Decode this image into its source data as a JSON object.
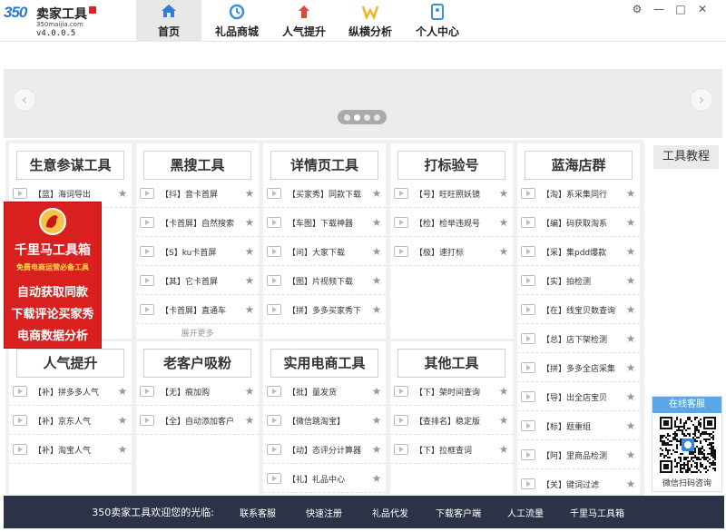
{
  "app": {
    "logo_mark": "350",
    "logo_name": "卖家工具",
    "logo_url": "350maijia.com",
    "version": "v4.0.0.5"
  },
  "nav": {
    "tabs": [
      {
        "label": "首页",
        "icon": "home-icon",
        "active": true
      },
      {
        "label": "礼品商城",
        "icon": "gift-mall-icon",
        "active": false
      },
      {
        "label": "人气提升",
        "icon": "popularity-icon",
        "active": false
      },
      {
        "label": "纵横分析",
        "icon": "analysis-icon",
        "active": false
      },
      {
        "label": "个人中心",
        "icon": "personal-center-icon",
        "active": false
      }
    ]
  },
  "window": {
    "settings": "⚙",
    "minimize": "—",
    "maximize": "□",
    "close": "✕"
  },
  "slider": {
    "prev": "‹",
    "next": "›",
    "dot_count": 4,
    "active_dot": 1
  },
  "cards": [
    {
      "title": "生意参谋工具",
      "items": [
        "【蓝】海词导出"
      ]
    },
    {
      "title": "黑搜工具",
      "items": [
        "【抖】音卡首屏",
        "【卡首屏】自然搜索",
        "【S】ku卡首屏",
        "【其】它卡首屏",
        "【卡首屏】直通车"
      ],
      "more": "展开更多"
    },
    {
      "title": "详情页工具",
      "items": [
        "【买家秀】同款下载",
        "【车图】下载神器",
        "【问】大家下载",
        "【图】片视频下载",
        "【拼】多多买家秀下"
      ]
    },
    {
      "title": "打标验号",
      "items": [
        "【号】旺旺照妖镜",
        "【检】检举违规号",
        "【极】速打标"
      ]
    },
    {
      "title": "蓝海店群",
      "items": [
        "【淘】系采集同行",
        "【编】码获取淘系",
        "【采】集pdd爆款",
        "【实】拍检测",
        "【在】线宝贝数查询",
        "【总】店下架检测",
        "【拼】多多全店采集",
        "【导】出全店宝贝",
        "【标】题重组",
        "【阿】里商品检测",
        "【关】键词过滤"
      ]
    },
    {
      "title": "人气提升",
      "items": [
        "【补】拼多多人气",
        "【补】京东人气",
        "【补】淘宝人气"
      ]
    },
    {
      "title": "老客户吸粉",
      "items": [
        "【无】痕加购",
        "【全】自动添加客户"
      ]
    },
    {
      "title": "实用电商工具",
      "items": [
        "【批】量发货",
        "【微信跳淘宝】",
        "【动】态评分计算器",
        "【礼】礼品中心"
      ]
    },
    {
      "title": "其他工具",
      "items": [
        "【下】架时间查询",
        "【查排名】稳定版",
        "【下】拉框查词"
      ]
    }
  ],
  "promo": {
    "title": "千里马工具箱",
    "subtitle": "免费电商运营必备工具",
    "lines": [
      "自动获取同款",
      "下载评论买家秀",
      "电商数据分析"
    ]
  },
  "right": {
    "tutorial": "工具教程",
    "service_title": "在线客服",
    "service_caption": "微信扫码咨询"
  },
  "footer": {
    "welcome": "350卖家工具欢迎您的光临:",
    "links": [
      "联系客服",
      "快速注册",
      "礼品代发",
      "下载客户端",
      "人工流量",
      "千里马工具箱"
    ]
  },
  "colors": {
    "nav_active_bg": "#e8e8e8",
    "promo_red": "#d9201e",
    "footer_bg": "#2c3346",
    "service_blue": "#59a7e8"
  }
}
